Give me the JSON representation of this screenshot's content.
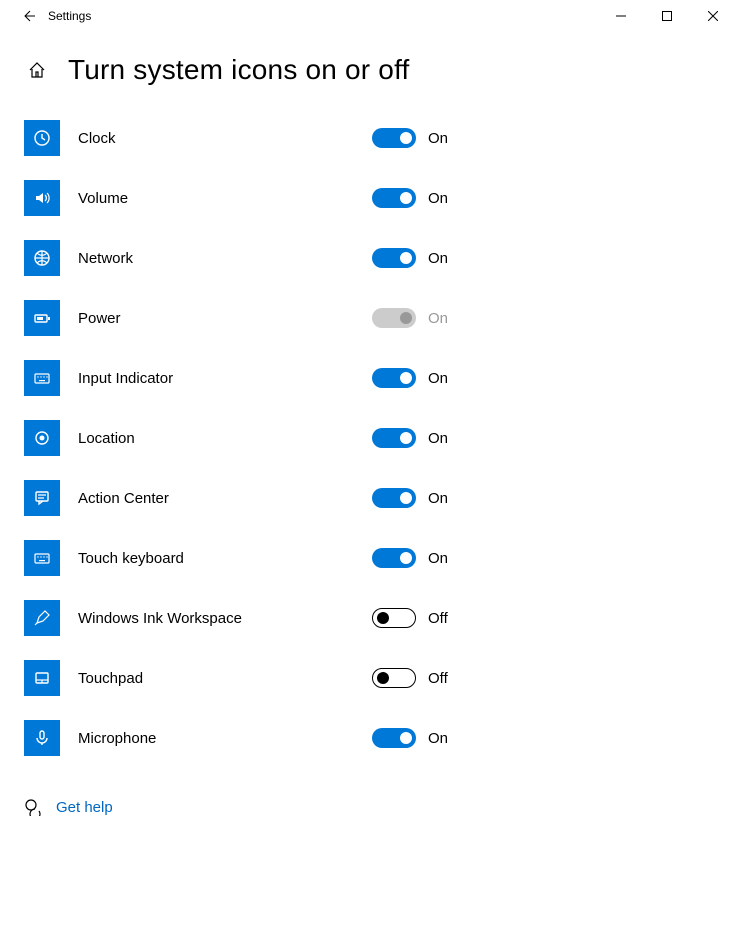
{
  "window": {
    "title": "Settings"
  },
  "page": {
    "heading": "Turn system icons on or off"
  },
  "items": [
    {
      "icon": "clock-icon",
      "label": "Clock",
      "state": "on",
      "stateLabel": "On"
    },
    {
      "icon": "volume-icon",
      "label": "Volume",
      "state": "on",
      "stateLabel": "On"
    },
    {
      "icon": "network-icon",
      "label": "Network",
      "state": "on",
      "stateLabel": "On"
    },
    {
      "icon": "power-icon",
      "label": "Power",
      "state": "disabled",
      "stateLabel": "On"
    },
    {
      "icon": "keyboard-icon",
      "label": "Input Indicator",
      "state": "on",
      "stateLabel": "On"
    },
    {
      "icon": "location-icon",
      "label": "Location",
      "state": "on",
      "stateLabel": "On"
    },
    {
      "icon": "action-center-icon",
      "label": "Action Center",
      "state": "on",
      "stateLabel": "On"
    },
    {
      "icon": "keyboard-icon",
      "label": "Touch keyboard",
      "state": "on",
      "stateLabel": "On"
    },
    {
      "icon": "pen-icon",
      "label": "Windows Ink Workspace",
      "state": "off",
      "stateLabel": "Off"
    },
    {
      "icon": "touchpad-icon",
      "label": "Touchpad",
      "state": "off",
      "stateLabel": "Off"
    },
    {
      "icon": "microphone-icon",
      "label": "Microphone",
      "state": "on",
      "stateLabel": "On"
    }
  ],
  "help": {
    "label": "Get help"
  }
}
